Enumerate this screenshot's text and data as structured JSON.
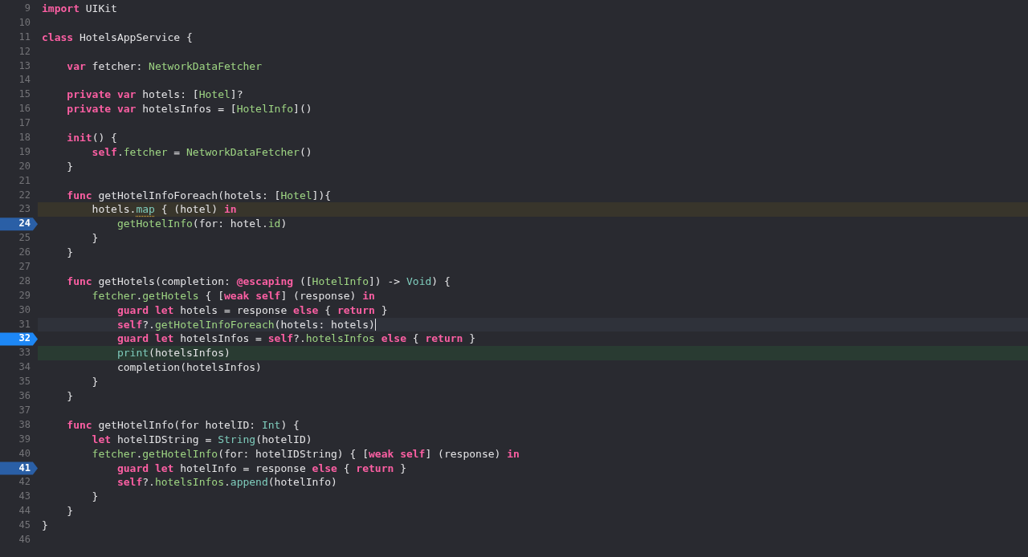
{
  "editor": {
    "lines": [
      {
        "n": "9",
        "breakpoint": false,
        "kind": "plain",
        "code": [
          {
            "text": "import",
            "kind": "kw"
          },
          {
            "text": " UIKit",
            "kind": "plain"
          }
        ]
      },
      {
        "n": "10",
        "breakpoint": false,
        "kind": "plain"
      },
      {
        "n": "11",
        "breakpoint": false,
        "kind": "plain",
        "code": [
          {
            "text": "class",
            "kind": "kw"
          },
          {
            "text": " HotelsAppService {",
            "kind": "plain"
          }
        ]
      },
      {
        "n": "12",
        "breakpoint": false,
        "kind": "plain"
      },
      {
        "n": "13",
        "breakpoint": false,
        "kind": "plain",
        "code": [
          {
            "text": "    var",
            "kind": "kw"
          },
          {
            "text": " fetcher: ",
            "kind": "plain"
          },
          {
            "text": "NetworkDataFetcher",
            "kind": "proj"
          }
        ]
      },
      {
        "n": "14",
        "breakpoint": false,
        "kind": "plain"
      },
      {
        "n": "15",
        "breakpoint": false,
        "kind": "plain",
        "code": [
          {
            "text": "    private var",
            "kind": "kw"
          },
          {
            "text": " hotels: [",
            "kind": "plain"
          },
          {
            "text": "Hotel",
            "kind": "proj"
          },
          {
            "text": "]?",
            "kind": "plain"
          }
        ]
      },
      {
        "n": "16",
        "breakpoint": false,
        "kind": "plain",
        "code": [
          {
            "text": "    private var",
            "kind": "kw"
          },
          {
            "text": " hotelsInfos = [",
            "kind": "plain"
          },
          {
            "text": "HotelInfo",
            "kind": "proj"
          },
          {
            "text": "]()",
            "kind": "plain"
          }
        ]
      },
      {
        "n": "17",
        "breakpoint": false,
        "kind": "plain"
      },
      {
        "n": "18",
        "breakpoint": false,
        "kind": "plain",
        "code": [
          {
            "text": "    init",
            "kind": "kw"
          },
          {
            "text": "() {",
            "kind": "plain"
          }
        ]
      },
      {
        "n": "19",
        "breakpoint": false,
        "kind": "plain",
        "code": [
          {
            "text": "        self",
            "kind": "kw"
          },
          {
            "text": ".",
            "kind": "plain"
          },
          {
            "text": "fetcher",
            "kind": "proj"
          },
          {
            "text": " = ",
            "kind": "plain"
          },
          {
            "text": "NetworkDataFetcher",
            "kind": "proj"
          },
          {
            "text": "()",
            "kind": "plain"
          }
        ]
      },
      {
        "n": "20",
        "breakpoint": false,
        "kind": "plain",
        "code": [
          {
            "text": "    }",
            "kind": "plain"
          }
        ]
      },
      {
        "n": "21",
        "breakpoint": false,
        "kind": "plain"
      },
      {
        "n": "22",
        "breakpoint": false,
        "kind": "plain",
        "code": [
          {
            "text": "    func",
            "kind": "kw"
          },
          {
            "text": " getHotelInfoForeach(hotels: [",
            "kind": "plain"
          },
          {
            "text": "Hotel",
            "kind": "proj"
          },
          {
            "text": "]){",
            "kind": "plain"
          }
        ]
      },
      {
        "n": "23",
        "breakpoint": false,
        "kind": "warning",
        "code": [
          {
            "text": "        hotels.",
            "kind": "plain"
          },
          {
            "text": "map",
            "kind": "flagged"
          },
          {
            "text": " { (hotel) ",
            "kind": "plain"
          },
          {
            "text": "in",
            "kind": "kw"
          }
        ]
      },
      {
        "n": "24",
        "breakpoint": true,
        "enabled": false,
        "kind": "plain",
        "code": [
          {
            "text": "            getHotelInfo",
            "kind": "proj"
          },
          {
            "text": "(for: hotel.",
            "kind": "plain"
          },
          {
            "text": "id",
            "kind": "proj"
          },
          {
            "text": ")",
            "kind": "plain"
          }
        ]
      },
      {
        "n": "25",
        "breakpoint": false,
        "kind": "plain",
        "code": [
          {
            "text": "        }",
            "kind": "plain"
          }
        ]
      },
      {
        "n": "26",
        "breakpoint": false,
        "kind": "plain",
        "code": [
          {
            "text": "    }",
            "kind": "plain"
          }
        ]
      },
      {
        "n": "27",
        "breakpoint": false,
        "kind": "plain"
      },
      {
        "n": "28",
        "breakpoint": false,
        "kind": "plain",
        "code": [
          {
            "text": "    func",
            "kind": "kw"
          },
          {
            "text": " getHotels(completion: ",
            "kind": "plain"
          },
          {
            "text": "@escaping",
            "kind": "kw"
          },
          {
            "text": " ([",
            "kind": "plain"
          },
          {
            "text": "HotelInfo",
            "kind": "proj"
          },
          {
            "text": "]) -> ",
            "kind": "plain"
          },
          {
            "text": "Void",
            "kind": "sys"
          },
          {
            "text": ") {",
            "kind": "plain"
          }
        ]
      },
      {
        "n": "29",
        "breakpoint": false,
        "kind": "plain",
        "code": [
          {
            "text": "        fetcher",
            "kind": "proj"
          },
          {
            "text": ".",
            "kind": "plain"
          },
          {
            "text": "getHotels",
            "kind": "proj"
          },
          {
            "text": " { [",
            "kind": "plain"
          },
          {
            "text": "weak self",
            "kind": "kw"
          },
          {
            "text": "] (response) ",
            "kind": "plain"
          },
          {
            "text": "in",
            "kind": "kw"
          }
        ]
      },
      {
        "n": "30",
        "breakpoint": false,
        "kind": "plain",
        "code": [
          {
            "text": "            guard let",
            "kind": "kw"
          },
          {
            "text": " hotels = response ",
            "kind": "plain"
          },
          {
            "text": "else",
            "kind": "kw"
          },
          {
            "text": " { ",
            "kind": "plain"
          },
          {
            "text": "return",
            "kind": "kw"
          },
          {
            "text": " }",
            "kind": "plain"
          }
        ]
      },
      {
        "n": "31",
        "breakpoint": false,
        "kind": "cursor",
        "code": [
          {
            "text": "            self",
            "kind": "kw"
          },
          {
            "text": "?.",
            "kind": "plain"
          },
          {
            "text": "getHotelInfoForeach",
            "kind": "proj"
          },
          {
            "text": "(hotels: hotels)",
            "kind": "plain"
          }
        ]
      },
      {
        "n": "32",
        "breakpoint": true,
        "enabled": true,
        "kind": "plain",
        "code": [
          {
            "text": "            guard let",
            "kind": "kw"
          },
          {
            "text": " hotelsInfos = ",
            "kind": "plain"
          },
          {
            "text": "self",
            "kind": "kw"
          },
          {
            "text": "?.",
            "kind": "plain"
          },
          {
            "text": "hotelsInfos",
            "kind": "proj"
          },
          {
            "text": " else",
            "kind": "kw"
          },
          {
            "text": " { ",
            "kind": "plain"
          },
          {
            "text": "return",
            "kind": "kw"
          },
          {
            "text": " }",
            "kind": "plain"
          }
        ]
      },
      {
        "n": "33",
        "breakpoint": false,
        "kind": "debug",
        "code": [
          {
            "text": "            print",
            "kind": "sys"
          },
          {
            "text": "(hotelsInfos)",
            "kind": "plain"
          }
        ]
      },
      {
        "n": "34",
        "breakpoint": false,
        "kind": "plain",
        "code": [
          {
            "text": "            completion(hotelsInfos)",
            "kind": "plain"
          }
        ]
      },
      {
        "n": "35",
        "breakpoint": false,
        "kind": "plain",
        "code": [
          {
            "text": "        }",
            "kind": "plain"
          }
        ]
      },
      {
        "n": "36",
        "breakpoint": false,
        "kind": "plain",
        "code": [
          {
            "text": "    }",
            "kind": "plain"
          }
        ]
      },
      {
        "n": "37",
        "breakpoint": false,
        "kind": "plain"
      },
      {
        "n": "38",
        "breakpoint": false,
        "kind": "plain",
        "code": [
          {
            "text": "    func",
            "kind": "kw"
          },
          {
            "text": " getHotelInfo(for hotelID: ",
            "kind": "plain"
          },
          {
            "text": "Int",
            "kind": "sys"
          },
          {
            "text": ") {",
            "kind": "plain"
          }
        ]
      },
      {
        "n": "39",
        "breakpoint": false,
        "kind": "plain",
        "code": [
          {
            "text": "        let",
            "kind": "kw"
          },
          {
            "text": " hotelIDString = ",
            "kind": "plain"
          },
          {
            "text": "String",
            "kind": "sys"
          },
          {
            "text": "(hotelID)",
            "kind": "plain"
          }
        ]
      },
      {
        "n": "40",
        "breakpoint": false,
        "kind": "plain",
        "code": [
          {
            "text": "        fetcher",
            "kind": "proj"
          },
          {
            "text": ".",
            "kind": "plain"
          },
          {
            "text": "getHotelInfo",
            "kind": "proj"
          },
          {
            "text": "(for: hotelIDString) { [",
            "kind": "plain"
          },
          {
            "text": "weak self",
            "kind": "kw"
          },
          {
            "text": "] (response) ",
            "kind": "plain"
          },
          {
            "text": "in",
            "kind": "kw"
          }
        ]
      },
      {
        "n": "41",
        "breakpoint": true,
        "enabled": false,
        "kind": "plain",
        "code": [
          {
            "text": "            guard let",
            "kind": "kw"
          },
          {
            "text": " hotelInfo = response ",
            "kind": "plain"
          },
          {
            "text": "else",
            "kind": "kw"
          },
          {
            "text": " { ",
            "kind": "plain"
          },
          {
            "text": "return",
            "kind": "kw"
          },
          {
            "text": " }",
            "kind": "plain"
          }
        ]
      },
      {
        "n": "42",
        "breakpoint": false,
        "kind": "plain",
        "code": [
          {
            "text": "            self",
            "kind": "kw"
          },
          {
            "text": "?.",
            "kind": "plain"
          },
          {
            "text": "hotelsInfos",
            "kind": "proj"
          },
          {
            "text": ".",
            "kind": "plain"
          },
          {
            "text": "append",
            "kind": "sys"
          },
          {
            "text": "(hotelInfo)",
            "kind": "plain"
          }
        ]
      },
      {
        "n": "43",
        "breakpoint": false,
        "kind": "plain",
        "code": [
          {
            "text": "        }",
            "kind": "plain"
          }
        ]
      },
      {
        "n": "44",
        "breakpoint": false,
        "kind": "plain",
        "code": [
          {
            "text": "    }",
            "kind": "plain"
          }
        ]
      },
      {
        "n": "45",
        "breakpoint": false,
        "kind": "plain",
        "code": [
          {
            "text": "}",
            "kind": "plain"
          }
        ]
      },
      {
        "n": "46",
        "breakpoint": false,
        "kind": "plain"
      }
    ]
  }
}
